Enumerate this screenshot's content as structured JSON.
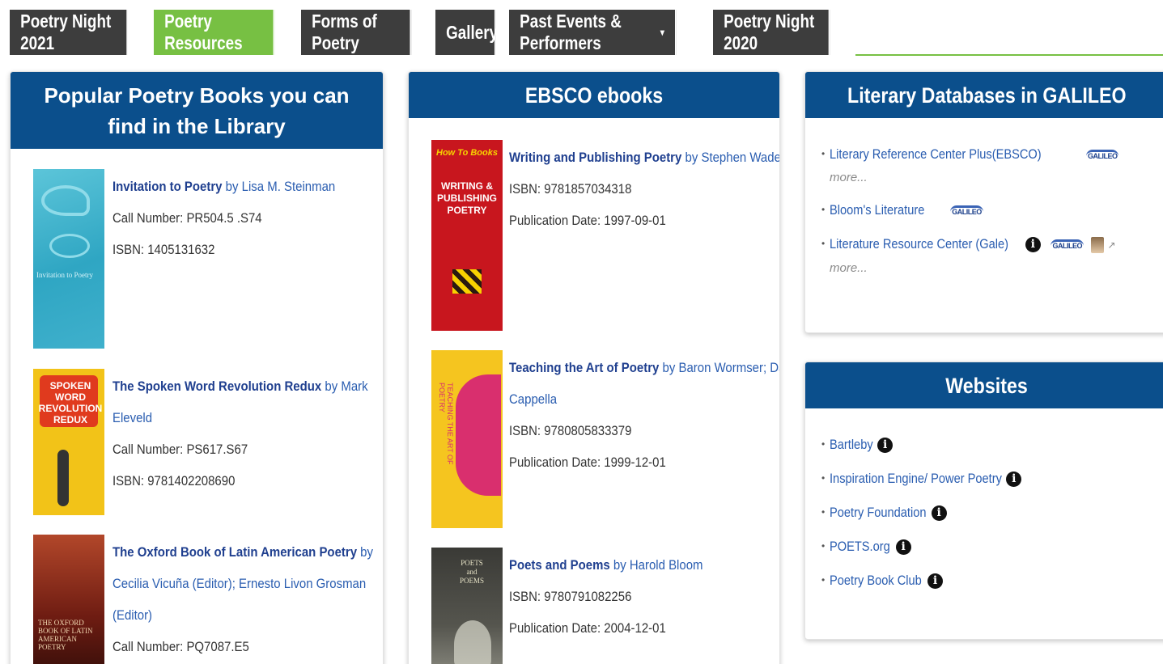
{
  "nav": {
    "tabs": [
      {
        "label": "Poetry Night 2021"
      },
      {
        "label": "Poetry Resources"
      },
      {
        "label": "Forms of Poetry"
      },
      {
        "label": "Gallery"
      },
      {
        "label": "Past Events & Performers"
      },
      {
        "label": "Poetry Night 2020"
      }
    ],
    "active_index": 1
  },
  "popular_books": {
    "title": "Popular Poetry Books you can find in the Library",
    "items": [
      {
        "title": "Invitation to Poetry",
        "by": "by",
        "author": "Lisa M. Steinman",
        "call_number": "Call Number: PR504.5 .S74",
        "isbn": "ISBN: 1405131632",
        "cover_text": "Invitation to Poetry"
      },
      {
        "title": "The Spoken Word Revolution Redux",
        "by": "by",
        "author": "Mark Eleveld",
        "call_number": "Call Number: PS617.S67",
        "isbn": "ISBN: 9781402208690",
        "cover_text": "SPOKEN WORD REVOLUTION REDUX"
      },
      {
        "title": "The Oxford Book of Latin American Poetry",
        "by": "by",
        "author": "Cecilia Vicuña (Editor); Ernesto Livon Grosman (Editor)",
        "call_number": "Call Number: PQ7087.E5",
        "cover_text": "THE OXFORD BOOK OF LATIN AMERICAN POETRY"
      }
    ]
  },
  "ebsco": {
    "title": "EBSCO ebooks",
    "items": [
      {
        "title": "Writing and Publishing Poetry",
        "by": "by",
        "author": "Stephen Wade",
        "isbn": "ISBN: 9781857034318",
        "pub_date": "Publication Date: 1997-09-01",
        "cover_text": "WRITING & PUBLISHING POETRY"
      },
      {
        "title": "Teaching the Art of Poetry",
        "by": "by",
        "author": "Baron Wormser; David Cappella",
        "isbn": "ISBN: 9780805833379",
        "pub_date": "Publication Date: 1999-12-01",
        "cover_text": "TEACHING THE ART OF POETRY"
      },
      {
        "title": "Poets and Poems",
        "by": "by",
        "author": "Harold Bloom",
        "isbn": "ISBN: 9780791082256",
        "pub_date": "Publication Date: 2004-12-01",
        "cover_text": "POETS and POEMS"
      }
    ]
  },
  "galileo": {
    "title": "Literary Databases in GALILEO",
    "items": [
      {
        "label": "Literary Reference Center Plus(EBSCO)",
        "more": "more..."
      },
      {
        "label": "Bloom's Literature"
      },
      {
        "label": "Literature Resource Center (Gale)",
        "more": "more..."
      }
    ],
    "badge": "GALILEO"
  },
  "websites": {
    "title": "Websites",
    "items": [
      {
        "label": "Bartleby"
      },
      {
        "label": "Inspiration Engine/ Power Poetry"
      },
      {
        "label": "Poetry Foundation"
      },
      {
        "label": "POETS.org"
      },
      {
        "label": "Poetry Book Club"
      }
    ]
  },
  "icons": {
    "info": "info-circle-icon",
    "external": "external-link-icon"
  },
  "colors": {
    "tab_bg": "#3d3d3d",
    "tab_active": "#77c043",
    "panel_head": "#0b4f8c",
    "link": "#2a5db0"
  }
}
